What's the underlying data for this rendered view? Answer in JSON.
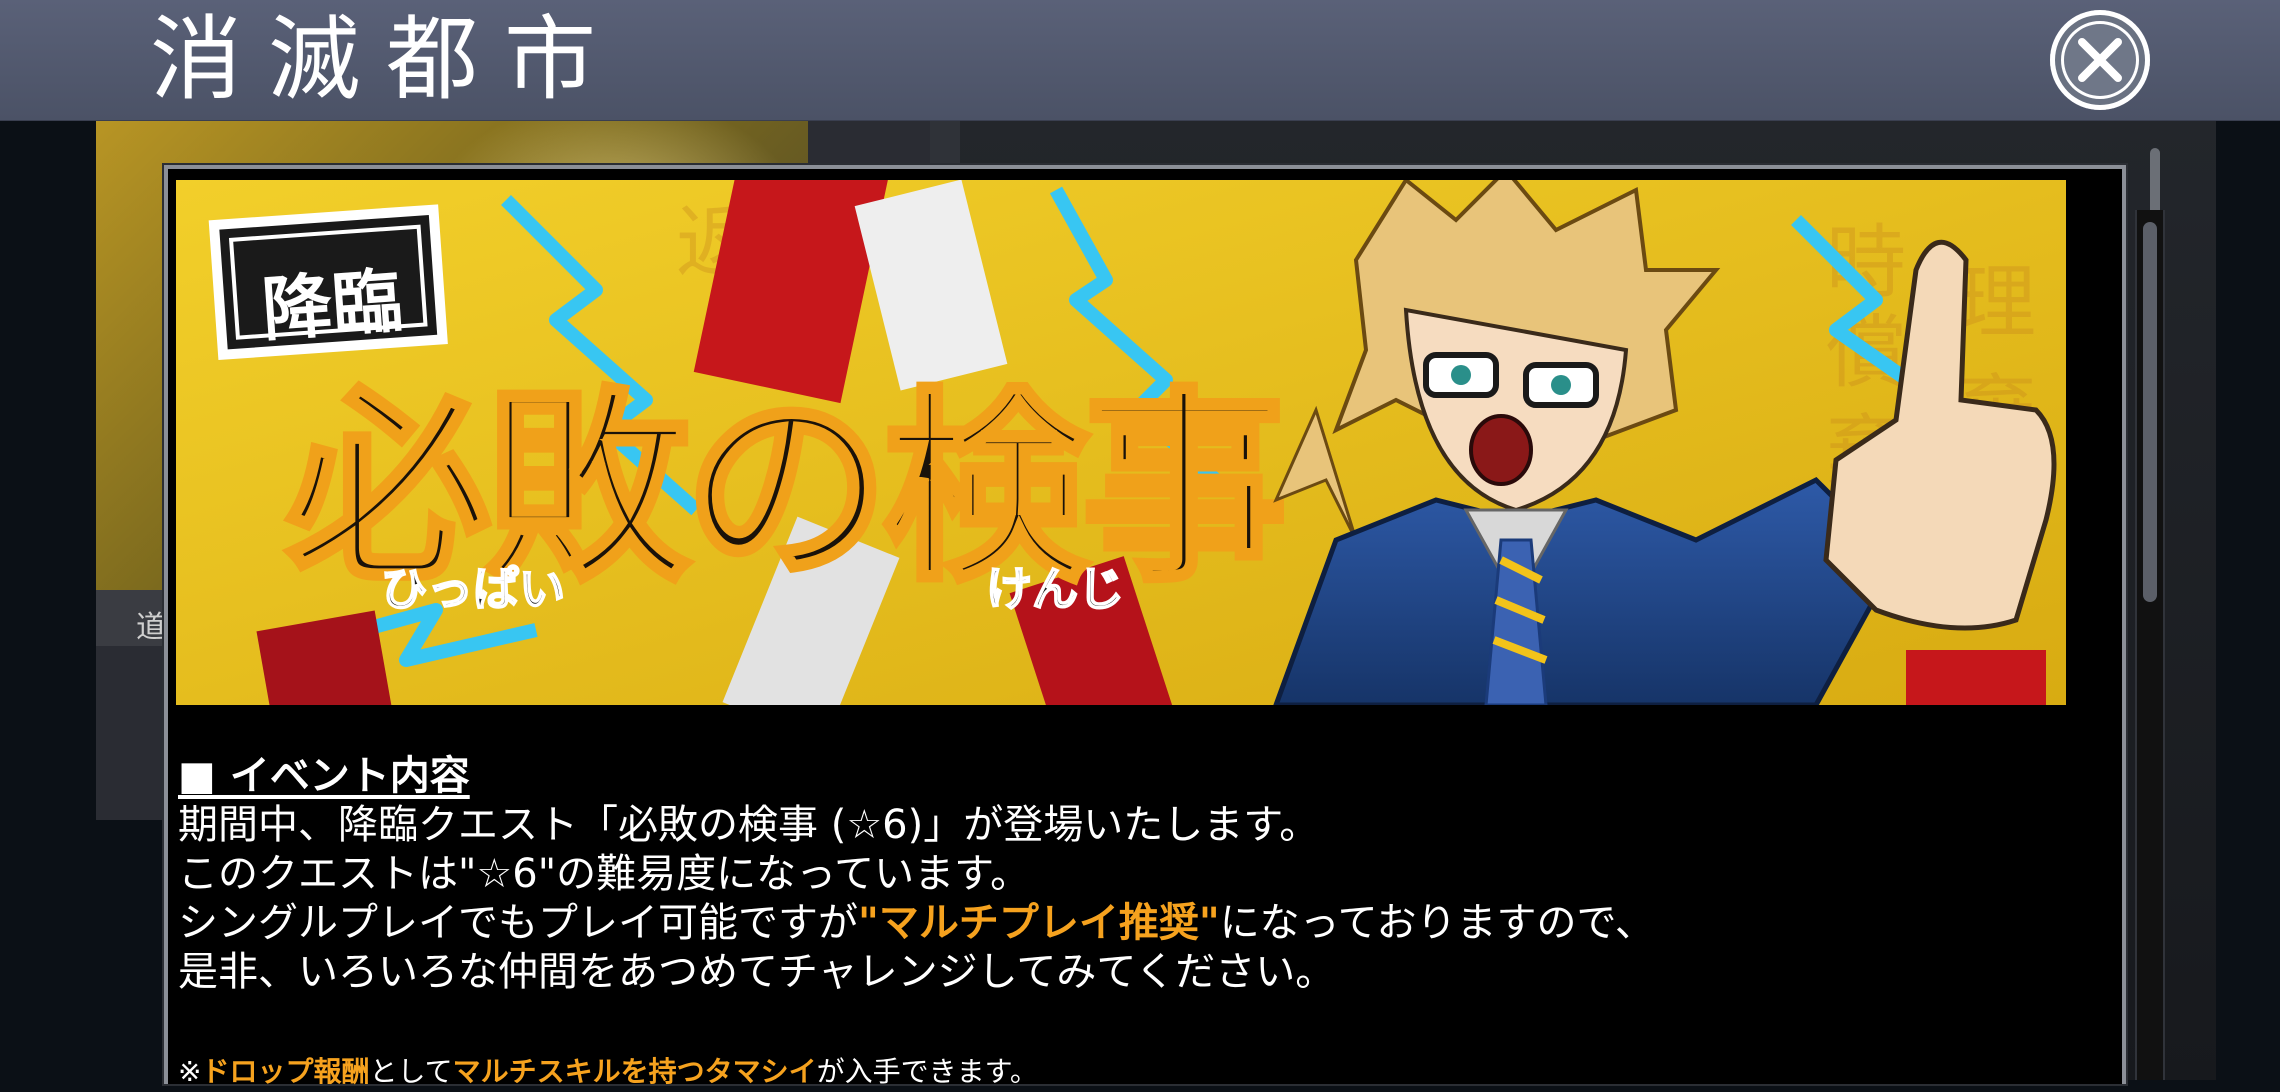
{
  "header": {
    "title": "消滅都市"
  },
  "background": {
    "strip_label": "道"
  },
  "banner": {
    "tag": "降臨",
    "title": "必敗の検事",
    "furigana_left": "ひっぱい",
    "furigana_right": "けんじ"
  },
  "event": {
    "heading": "■ イベント内容",
    "line1": "期間中、降臨クエスト「必敗の検事 (☆6)」が登場いたします。",
    "line2": "このクエストは\"☆6\"の難易度になっています。",
    "line3_pre": "シングルプレイでもプレイ可能ですが",
    "line3_highlight": "\"マルチプレイ推奨\"",
    "line3_post": "になっておりますので、",
    "line4": "是非、いろいろな仲間をあつめてチャレンジしてみてください。",
    "note_prefix": "※",
    "note_h1": "ドロップ報酬",
    "note_mid": "として",
    "note_h2": "マルチスキルを持つタマシイ",
    "note_post": "が入手できます。"
  },
  "colors": {
    "accent_orange": "#f6a21e",
    "header_bg": "#525970",
    "banner_yellow": "#e7c11a"
  },
  "icons": {
    "close": "close-icon"
  }
}
